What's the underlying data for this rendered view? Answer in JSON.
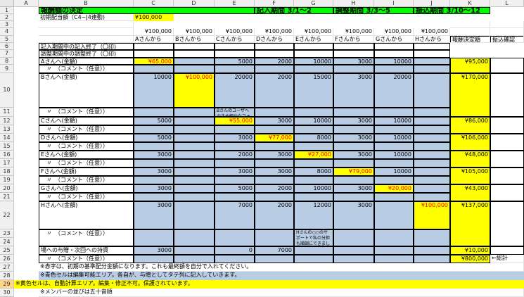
{
  "columns": [
    "A",
    "B",
    "C",
    "D",
    "E",
    "F",
    "G",
    "H",
    "I",
    "J",
    "K",
    "L"
  ],
  "rows": [
    "1",
    "2",
    "3",
    "4",
    "5",
    "6",
    "7",
    "8",
    "9",
    "10",
    "11",
    "12",
    "13",
    "14",
    "15",
    "16",
    "17",
    "18",
    "19",
    "20",
    "21",
    "22",
    "23",
    "24",
    "25",
    "26",
    "27",
    "28",
    "29",
    "30"
  ],
  "selected_row": "29",
  "header": {
    "title": "報酬額の決定",
    "p1": "記入期間 3/1〜2",
    "p2": "調整期間 3/3〜5",
    "p3": "振込期間 3/10〜12"
  },
  "row2": {
    "label": "初期配当額（C4~J4連動)",
    "value": "¥100,000"
  },
  "base_amounts": [
    "¥100,000",
    "¥100,000",
    "¥100,000",
    "¥100,000",
    "¥100,000",
    "¥100,000",
    "¥100,000",
    "¥100,000"
  ],
  "from_labels": [
    "Aさんから",
    "Bさんから",
    "Cさんから",
    "Dさんから",
    "Eさんから",
    "Fさんから",
    "Gさんから",
    "Hさんから"
  ],
  "col_k_header": "報酬決定額",
  "col_l_header": "振込確認",
  "row6": "記入期間中の記入終了（〇印)",
  "row7": "調整期間中の調整終了（〇印)",
  "persons": [
    {
      "amount_label": "Aさんへ(金額)",
      "comment_label": "　〃　（コメント（任意））",
      "values": [
        "¥65,000",
        "",
        "5000",
        "2000",
        "10000",
        "3000",
        "10000",
        ""
      ],
      "total": "¥95,000"
    },
    {
      "amount_label": "Bさんへ(金額)",
      "comment_label": "　〃　（コメント（任意））",
      "values": [
        "10000",
        "¥100,000",
        "20000",
        "2000",
        "15000",
        "3000",
        "20000",
        ""
      ],
      "total": "¥170,000"
    },
    {
      "amount_label": "Cさんへ(金額)",
      "comment_label": "　〃　（コメント（任意））",
      "values": [
        "5000",
        "",
        "¥55,000",
        "3000",
        "10000",
        "3000",
        "10000",
        ""
      ],
      "total": "¥86,000"
    },
    {
      "amount_label": "Dさんへ(金額)",
      "comment_label": "　〃　（コメント（任意））",
      "values": [
        "5000",
        "",
        "3000",
        "¥77,000",
        "8000",
        "3000",
        "10000",
        ""
      ],
      "total": "¥106,000"
    },
    {
      "amount_label": "Eさんへ(金額)",
      "comment_label": "　〃　（コメント（任意））",
      "values": [
        "3000",
        "",
        "2000",
        "3000",
        "¥27,000",
        "3000",
        "10000",
        ""
      ],
      "total": "¥48,000"
    },
    {
      "amount_label": "Fさんへ(金額)",
      "comment_label": "　〃　（コメント（任意））",
      "values": [
        "3000",
        "",
        "3000",
        "3000",
        "8000",
        "¥79,000",
        "10000",
        ""
      ],
      "total": "¥105,000"
    },
    {
      "amount_label": "Gさんへ(金額)",
      "comment_label": "　〃　（コメント（任意））",
      "values": [
        "3000",
        "",
        "5000",
        "2000",
        "10000",
        "3000",
        "¥20,000",
        ""
      ],
      "total": "¥43,000"
    },
    {
      "amount_label": "Hさんへ(金額)",
      "comment_label": "　〃　（コメント（任意））",
      "values": [
        "3000",
        "",
        "7000",
        "2000",
        "12000",
        "3000",
        "",
        "¥100,000"
      ],
      "total": "¥137,000"
    }
  ],
  "comment_b": "Bさんのユーザへのきめ細かなフォローでプロジェクト全体が盛り上がりました。ありがとうございます。",
  "comment_h": "Hさんの○○のサポートで私の分担も順調にできました。ありがとうございます",
  "row25": {
    "label": "場への与贈・次回への持資",
    "values": [
      "3000",
      "",
      "0",
      "7000",
      "",
      "",
      "",
      ""
    ],
    "total": "¥10,000"
  },
  "row26": {
    "label": "　〃　（コメント（任意））",
    "total": "¥800,000",
    "note": "←総計"
  },
  "notes": {
    "r27": "※赤字は、初期の基準配分金額になります。これも最終額を自分で入れてください。",
    "r28": "※青色セルは編集可能エリア。各自が、与贈としてタテ列に記入していきます。",
    "r29": "※黄色セルは、自動計算エリア。編集・修正不可。保護されています。",
    "r30": "※メンバーの並びは五十音順"
  }
}
